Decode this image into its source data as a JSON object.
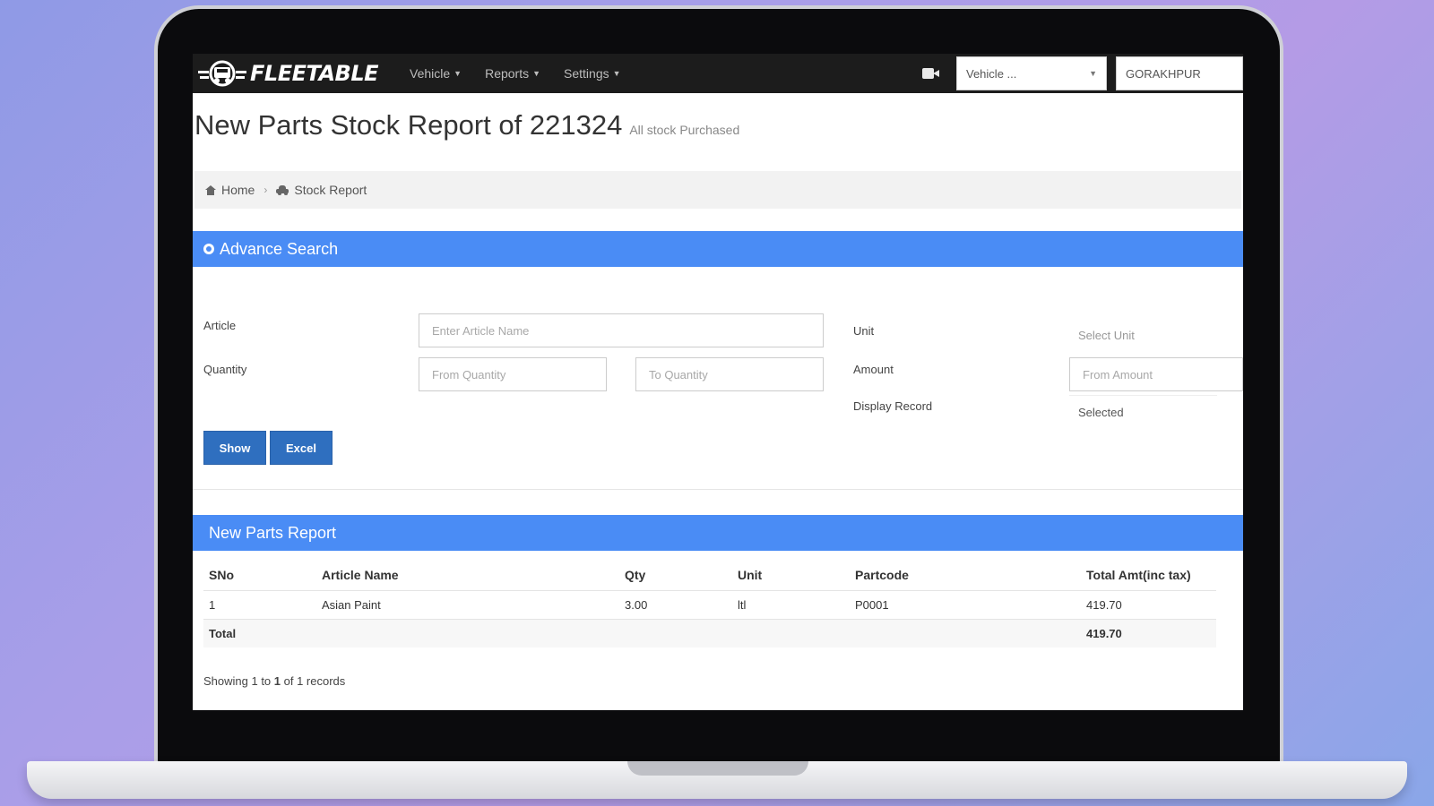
{
  "navbar": {
    "brand": "FLEETABLE",
    "menu": [
      {
        "label": "Vehicle"
      },
      {
        "label": "Reports"
      },
      {
        "label": "Settings"
      }
    ],
    "vehicle_select": "Vehicle ...",
    "city": "GORAKHPUR"
  },
  "page": {
    "title": "New Parts Stock Report of 221324",
    "subtitle": "All stock Purchased"
  },
  "breadcrumb": {
    "home": "Home",
    "current": "Stock Report"
  },
  "advance_search": {
    "title": "Advance Search",
    "article_label": "Article",
    "article_placeholder": "Enter Article Name",
    "quantity_label": "Quantity",
    "from_quantity_placeholder": "From Quantity",
    "to_quantity_placeholder": "To Quantity",
    "unit_label": "Unit",
    "unit_placeholder": "Select Unit",
    "amount_label": "Amount",
    "from_amount_placeholder": "From Amount",
    "display_record_label": "Display Record",
    "display_record_value": "Selected",
    "show_button": "Show",
    "excel_button": "Excel"
  },
  "report": {
    "title": "New Parts Report",
    "columns": [
      "SNo",
      "Article Name",
      "Qty",
      "Unit",
      "Partcode",
      "Total Amt(inc tax)"
    ],
    "rows": [
      [
        "1",
        "Asian Paint",
        "3.00",
        "ltl",
        "P0001",
        "419.70"
      ]
    ],
    "total_label": "Total",
    "total_amount": "419.70",
    "showing_prefix": "Showing 1 to ",
    "showing_bold": "1",
    "showing_suffix": " of 1 records"
  }
}
